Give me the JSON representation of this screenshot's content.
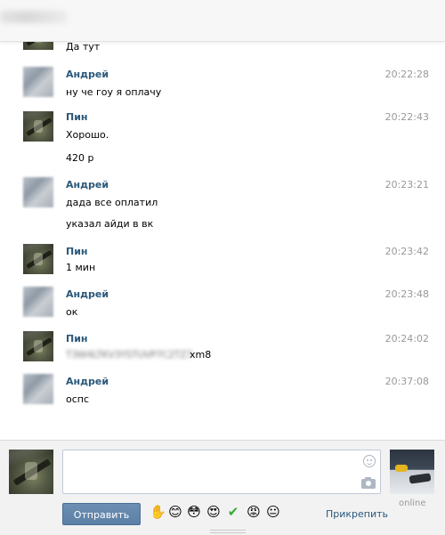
{
  "top": {
    "partial_message": "Да тут"
  },
  "messages": [
    {
      "author": "Андрей",
      "time": "20:22:28",
      "lines": [
        "ну че гоу я оплачу"
      ]
    },
    {
      "author": "Пин",
      "time": "20:22:43",
      "lines": [
        "Хорошо.",
        "420 р"
      ]
    },
    {
      "author": "Андрей",
      "time": "20:23:21",
      "lines": [
        "дада все оплатил",
        "указал айди в вк"
      ]
    },
    {
      "author": "Пин",
      "time": "20:23:42",
      "lines": [
        "1 мин"
      ]
    },
    {
      "author": "Андрей",
      "time": "20:23:48",
      "lines": [
        "ок"
      ]
    },
    {
      "author": "Пин",
      "time": "20:24:02",
      "lines": [
        "T3W4LTKV3YSTUVP7C2TZ7",
        "xm8"
      ]
    },
    {
      "author": "Андрей",
      "time": "20:37:08",
      "lines": [
        "оспс"
      ]
    }
  ],
  "composer": {
    "send_label": "Отправить",
    "attach_label": "Прикрепить",
    "contact_status": "online",
    "emojis": [
      "✋",
      "😊",
      "😳",
      "😍",
      "✔",
      "😡",
      "😐"
    ]
  },
  "colors": {
    "author": "#2b587a",
    "send_button": "#5b7fa6",
    "time": "#999999"
  }
}
